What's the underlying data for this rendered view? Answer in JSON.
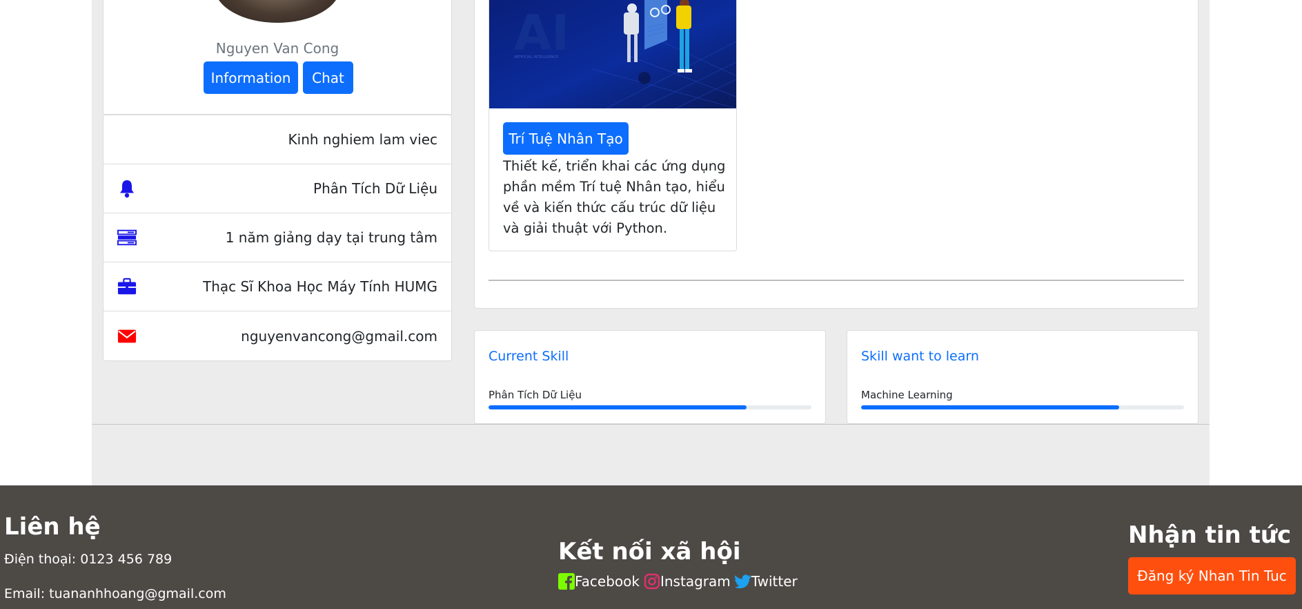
{
  "profile": {
    "name": "Nguyen Van Cong",
    "info_button": "Information",
    "chat_button": "Chat"
  },
  "info_list": {
    "heading": "Kinh nghiem lam viec",
    "items": [
      {
        "icon": "bell-icon",
        "text": "Phân Tích Dữ Liệu"
      },
      {
        "icon": "server-icon",
        "text": "1 năm giảng dạy tại trung tâm"
      },
      {
        "icon": "briefcase-icon",
        "text": "Thạc Sĩ Khoa Học Máy Tính HUMG"
      },
      {
        "icon": "envelope-icon",
        "text": "nguyenvancong@gmail.com"
      }
    ]
  },
  "course": {
    "image_text": "AI",
    "image_caption": "ARTIFICIAL INTELLIGENCE",
    "button": "Trí Tuệ Nhân Tạo",
    "description": "Thiết kế, triển khai các ứng dụng phần mềm Trí tuệ Nhân tạo, hiểu về và kiến thức cấu trúc dữ liệu và giải thuật với Python."
  },
  "skills": {
    "current": {
      "title": "Current Skill",
      "label": "Phân Tích Dữ Liệu",
      "progress": 0.8
    },
    "want": {
      "title": "Skill want to learn",
      "label": "Machine Learning",
      "progress": 0.8
    }
  },
  "footer": {
    "contact_title": "Liên hệ",
    "phone": "Điện thoại: 0123 456 789",
    "email": "Email: tuananhhoang@gmail.com",
    "social_title": "Kết nối xã hội",
    "social": [
      {
        "icon": "facebook-icon",
        "label": "Facebook",
        "color": "#7cfc00"
      },
      {
        "icon": "instagram-icon",
        "label": "Instagram",
        "color": "#e1306c"
      },
      {
        "icon": "twitter-icon",
        "label": "Twitter",
        "color": "#1da1f2"
      }
    ],
    "news_title": "Nhận tin tức",
    "subscribe_button": "Đăng ký Nhan Tin Tuc"
  },
  "colors": {
    "primary": "#0d6efd",
    "icon_blue": "#1a16e8",
    "icon_red": "#ff0000",
    "footer_bg": "#4d4a46",
    "subscribe_bg": "#ff4f0e",
    "page_bg": "#ececec"
  }
}
